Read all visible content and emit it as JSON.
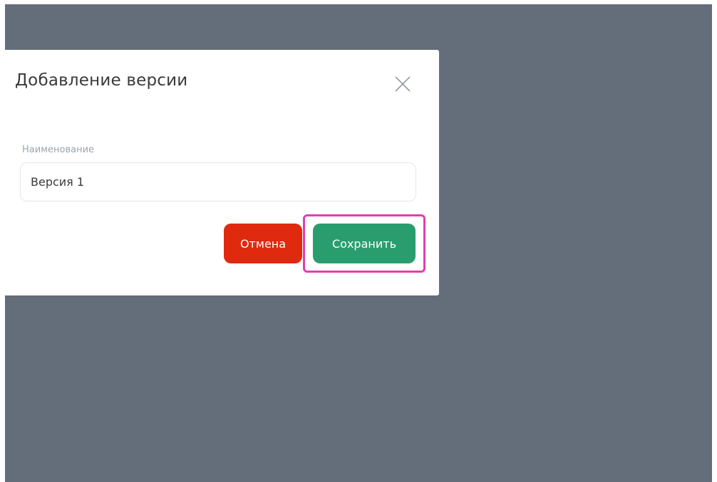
{
  "dialog": {
    "title": "Добавление версии",
    "close_icon": "close-icon",
    "name_field": {
      "label": "Наименование",
      "value": "Версия 1",
      "placeholder": ""
    },
    "buttons": {
      "cancel_label": "Отмена",
      "save_label": "Сохранить"
    }
  },
  "colors": {
    "overlay": "#646d7a",
    "cancel_button": "#e02a0f",
    "save_button": "#2a9d6f",
    "highlight": "#e040b0"
  }
}
